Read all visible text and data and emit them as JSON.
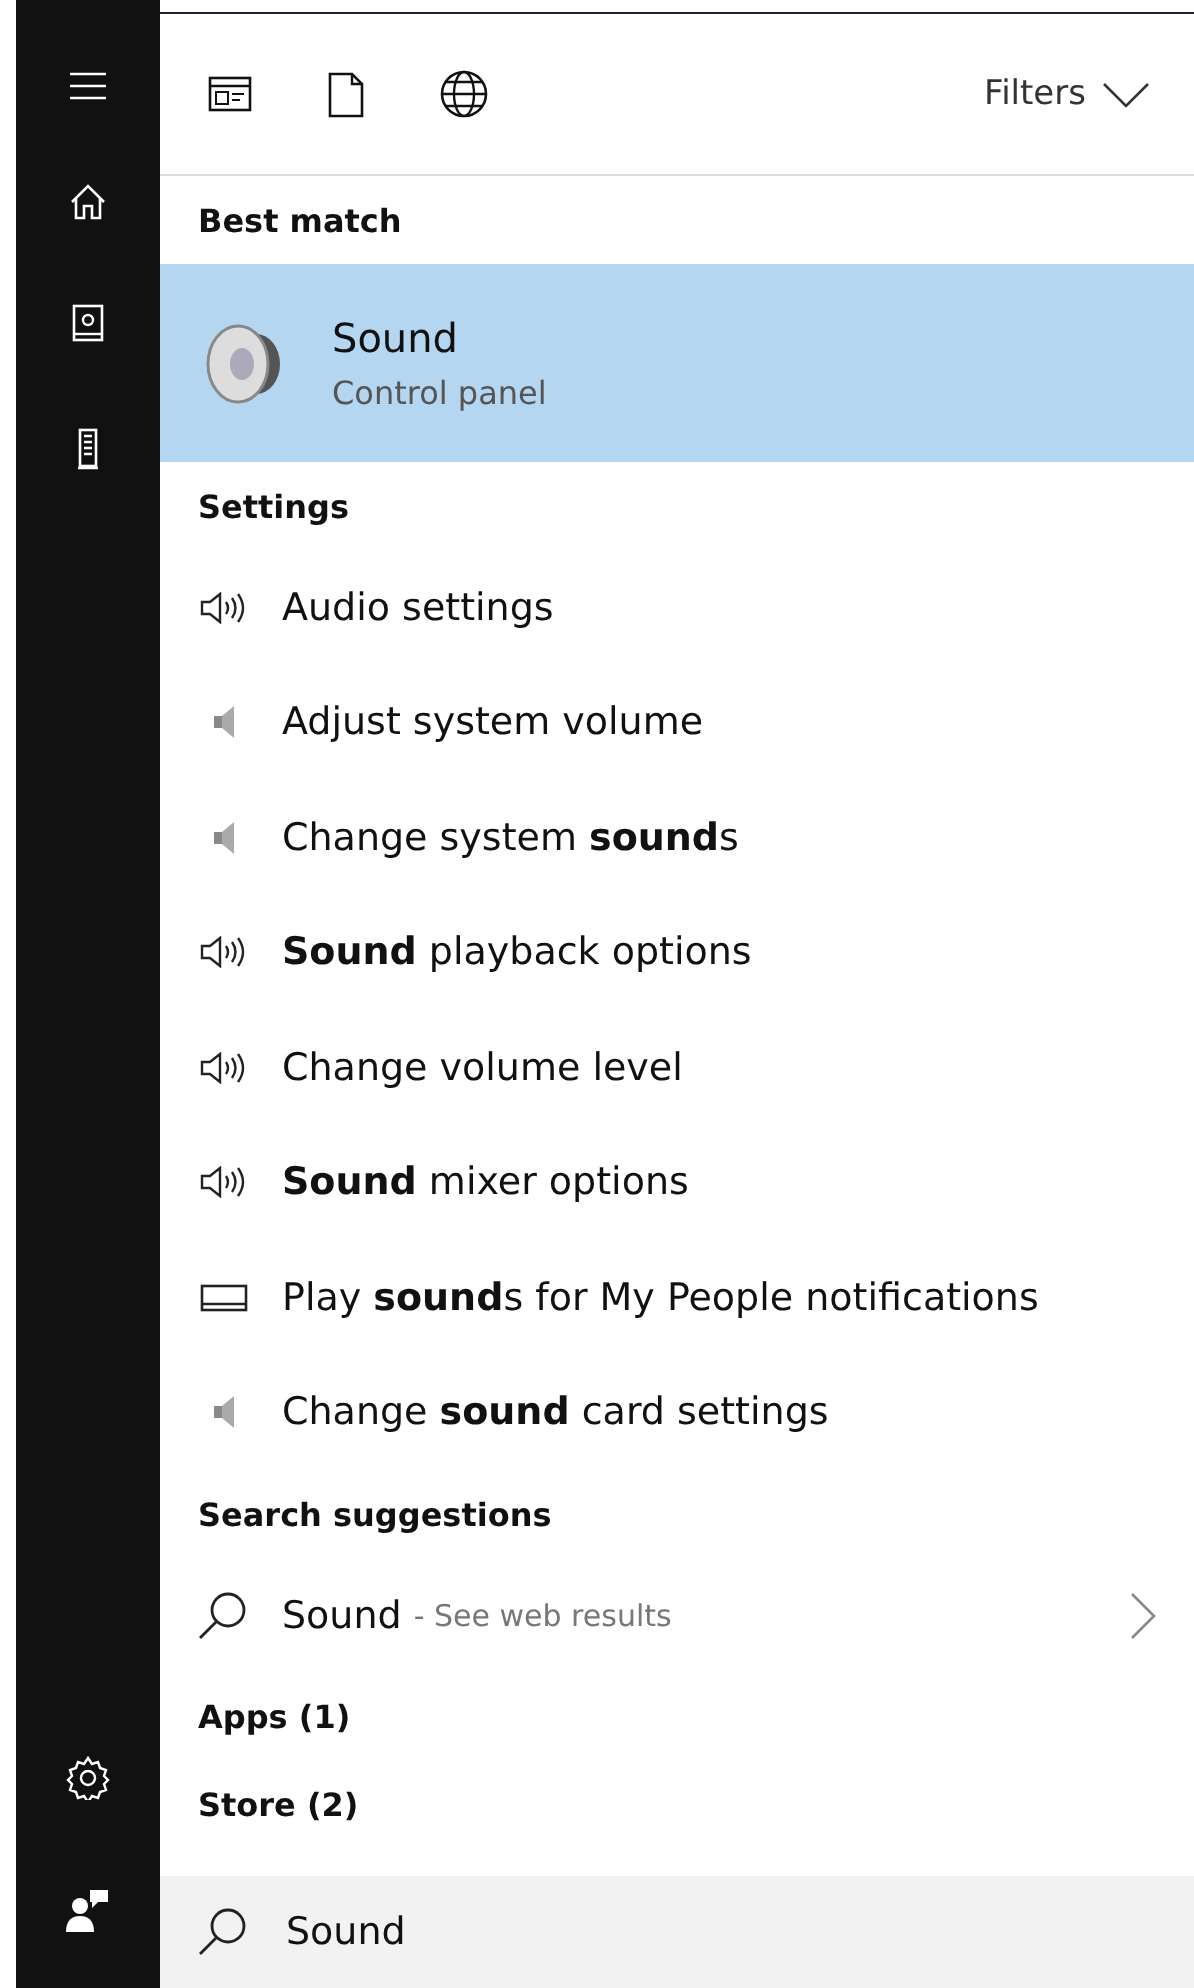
{
  "sidebar": {
    "items": [
      {
        "kind": "menu"
      },
      {
        "kind": "home"
      },
      {
        "kind": "notebook"
      },
      {
        "kind": "device"
      }
    ],
    "bottom_items": [
      {
        "kind": "settings"
      },
      {
        "kind": "feedback"
      }
    ]
  },
  "toolbar": {
    "scopes": [
      {
        "kind": "apps"
      },
      {
        "kind": "documents"
      },
      {
        "kind": "web"
      }
    ],
    "filters_label": "Filters"
  },
  "best_match": {
    "heading": "Best match",
    "title": "Sound",
    "subtitle": "Control panel",
    "selected": true
  },
  "settings": {
    "heading": "Settings",
    "items": [
      {
        "kind": "speaker-waves",
        "label": "Audio settings"
      },
      {
        "kind": "speaker",
        "label": "Adjust system volume"
      },
      {
        "kind": "speaker",
        "label": "Change system **sound**s"
      },
      {
        "kind": "speaker-waves",
        "label": "**Sound** playback options"
      },
      {
        "kind": "speaker-waves",
        "label": "Change volume level"
      },
      {
        "kind": "speaker-waves",
        "label": "**Sound** mixer options"
      },
      {
        "kind": "monitor",
        "label": "Play **sound**s for My People notifications"
      },
      {
        "kind": "speaker",
        "label": "Change **sound** card settings"
      }
    ]
  },
  "search_suggestions": {
    "heading": "Search suggestions",
    "items": [
      {
        "query": "Sound",
        "hint": "- See web results"
      }
    ]
  },
  "apps": {
    "heading": "Apps (1)"
  },
  "store": {
    "heading": "Store (2)"
  },
  "search_box": {
    "value": "Sound"
  }
}
